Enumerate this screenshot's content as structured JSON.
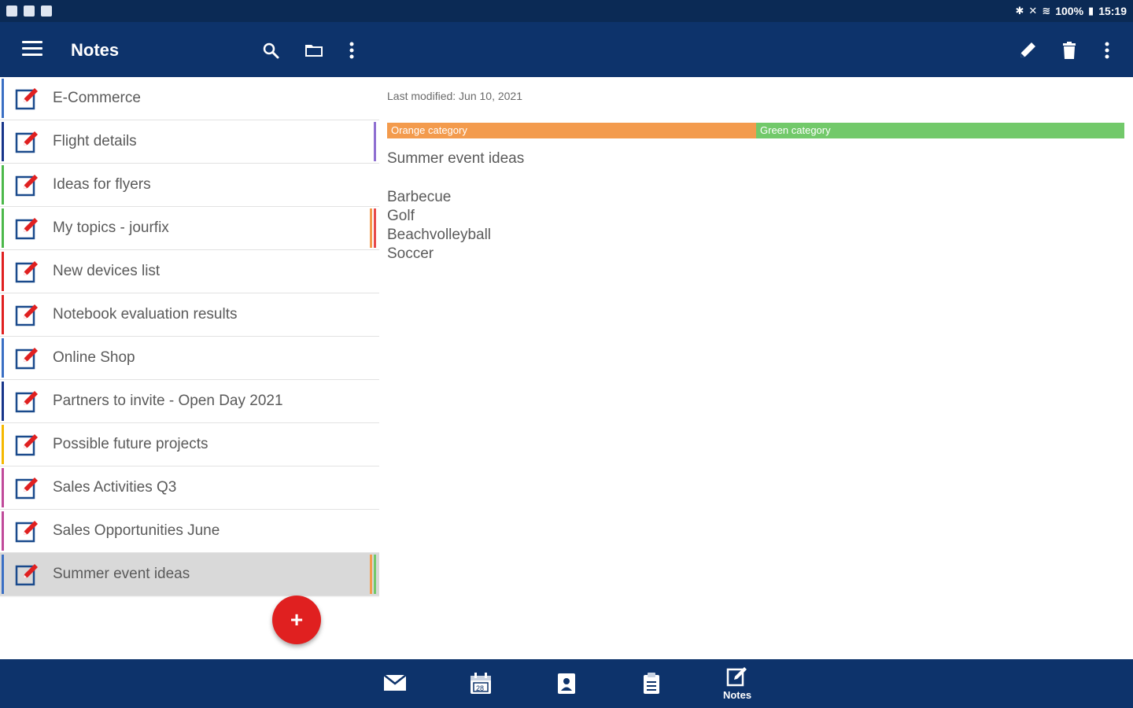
{
  "status_bar": {
    "battery": "100%",
    "time": "15:19"
  },
  "app_bar": {
    "title": "Notes"
  },
  "notes": [
    {
      "label": "E-Commerce",
      "left_color": "#3a6fc4",
      "right_colors": []
    },
    {
      "label": "Flight details",
      "left_color": "#17358a",
      "right_colors": [
        "#8f6fd1"
      ]
    },
    {
      "label": "Ideas for flyers",
      "left_color": "#4cb84a",
      "right_colors": []
    },
    {
      "label": "My topics - jourfix",
      "left_color": "#4cb84a",
      "right_colors": [
        "#f39b4d",
        "#e84a4a"
      ]
    },
    {
      "label": "New devices list",
      "left_color": "#e02020",
      "right_colors": []
    },
    {
      "label": "Notebook evaluation results",
      "left_color": "#e02020",
      "right_colors": []
    },
    {
      "label": "Online Shop",
      "left_color": "#3a6fc4",
      "right_colors": []
    },
    {
      "label": "Partners to invite - Open Day 2021",
      "left_color": "#17358a",
      "right_colors": []
    },
    {
      "label": "Possible future projects",
      "left_color": "#f5b800",
      "right_colors": []
    },
    {
      "label": "Sales Activities Q3",
      "left_color": "#c04a9a",
      "right_colors": []
    },
    {
      "label": "Sales Opportunities June",
      "left_color": "#c04a9a",
      "right_colors": []
    },
    {
      "label": "Summer event ideas",
      "left_color": "#3a6fc4",
      "right_colors": [
        "#f39b4d",
        "#72c96a"
      ],
      "selected": true
    }
  ],
  "detail": {
    "last_modified": "Last modified: Jun 10, 2021",
    "categories": [
      {
        "label": "Orange category",
        "color": "#f39b4d"
      },
      {
        "label": "Green category",
        "color": "#72c96a"
      }
    ],
    "title": "Summer event ideas",
    "body_lines": [
      "Barbecue",
      "Golf",
      "Beachvolleyball",
      "Soccer"
    ]
  },
  "fab": {
    "symbol": "+"
  },
  "bottom_nav": {
    "items": [
      {
        "name": "mail-icon"
      },
      {
        "name": "calendar-icon"
      },
      {
        "name": "contacts-icon"
      },
      {
        "name": "tasks-icon"
      },
      {
        "name": "notes-icon",
        "label": "Notes",
        "active": true
      }
    ]
  }
}
